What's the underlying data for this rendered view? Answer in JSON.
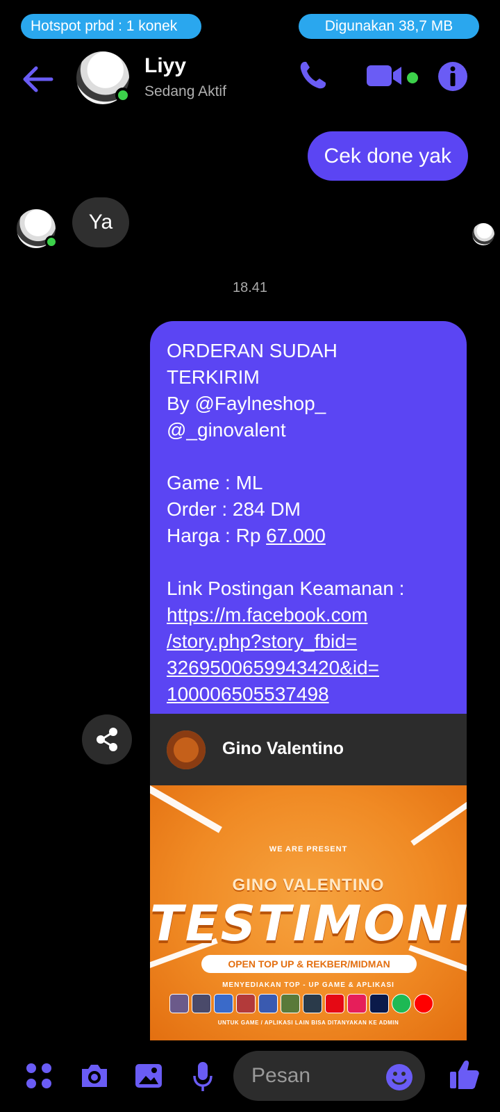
{
  "status_bar": {
    "hotspot": "Hotspot prbd : 1 konek",
    "data_used": "Digunakan 38,7 MB"
  },
  "header": {
    "name": "Liyy",
    "status": "Sedang Aktif"
  },
  "messages": {
    "outgoing_1": "Cek done yak",
    "incoming_1": "Ya",
    "timestamp": "18.41",
    "order": {
      "line1": "ORDERAN SUDAH",
      "line2": "TERKIRIM",
      "line3": "By @Faylneshop_",
      "line4": "@_ginovalent",
      "game": "Game : ML",
      "order": "Order : 284 DM",
      "harga_prefix": "Harga : Rp ",
      "harga_value": "67.000",
      "link_label": "Link Postingan Keamanan :",
      "link1": "https://m.facebook.com",
      "link2": "/story.php?story_fbid=",
      "link3": "3269500659943420&id=",
      "link4": "100006505537498"
    },
    "link_preview": {
      "name": "Gino Valentino",
      "image": {
        "present": "WE ARE PRESENT",
        "brand": "GINO VALENTINO",
        "title": "TESTIMONI",
        "banner": "OPEN TOP UP & REKBER/MIDMAN",
        "provide": "MENYEDIAKAN TOP - UP GAME & APLIKASI",
        "footer": "UNTUK GAME / APLIKASI LAIN BISA DITANYAKAN KE ADMIN"
      }
    }
  },
  "composer": {
    "placeholder": "Pesan"
  },
  "colors": {
    "accent": "#5b45f3",
    "online": "#3cd14a",
    "status_pill": "#2aa7ee"
  }
}
